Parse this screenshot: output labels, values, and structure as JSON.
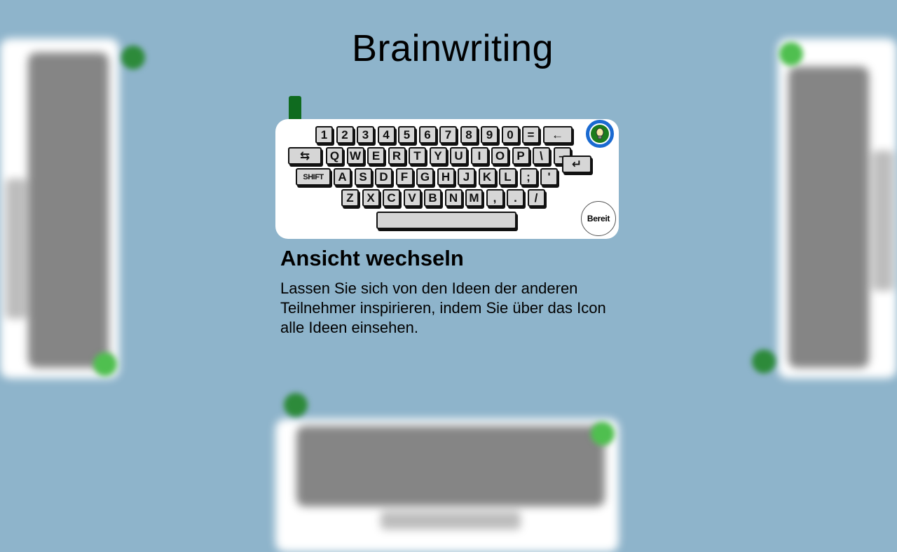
{
  "title": "Brainwriting",
  "keyboard": {
    "row1": [
      "1",
      "2",
      "3",
      "4",
      "5",
      "6",
      "7",
      "8",
      "9",
      "0",
      "=",
      "←"
    ],
    "row2": [
      "⇆",
      "Q",
      "W",
      "E",
      "R",
      "T",
      "Y",
      "U",
      "I",
      "O",
      "P",
      "\\",
      "–"
    ],
    "row3": [
      "SHIFT",
      "A",
      "S",
      "D",
      "F",
      "G",
      "H",
      "J",
      "K",
      "L",
      ";",
      "'"
    ],
    "row4": [
      "Z",
      "X",
      "C",
      "V",
      "B",
      "N",
      "M",
      ",",
      ".",
      "/"
    ],
    "enter": "↵",
    "ready_button": "Bereit",
    "view_icon": "lightbulb-icon"
  },
  "tip": {
    "heading": "Ansicht wechseln",
    "text": "Lassen Sie sich von den Ideen der anderen Teilnehmer inspirieren, indem Sie über das Icon alle Ideen einsehen."
  },
  "colors": {
    "background": "#8eb4cb",
    "accent_ring": "#1a6ad1",
    "green": "#1c7c1c"
  }
}
